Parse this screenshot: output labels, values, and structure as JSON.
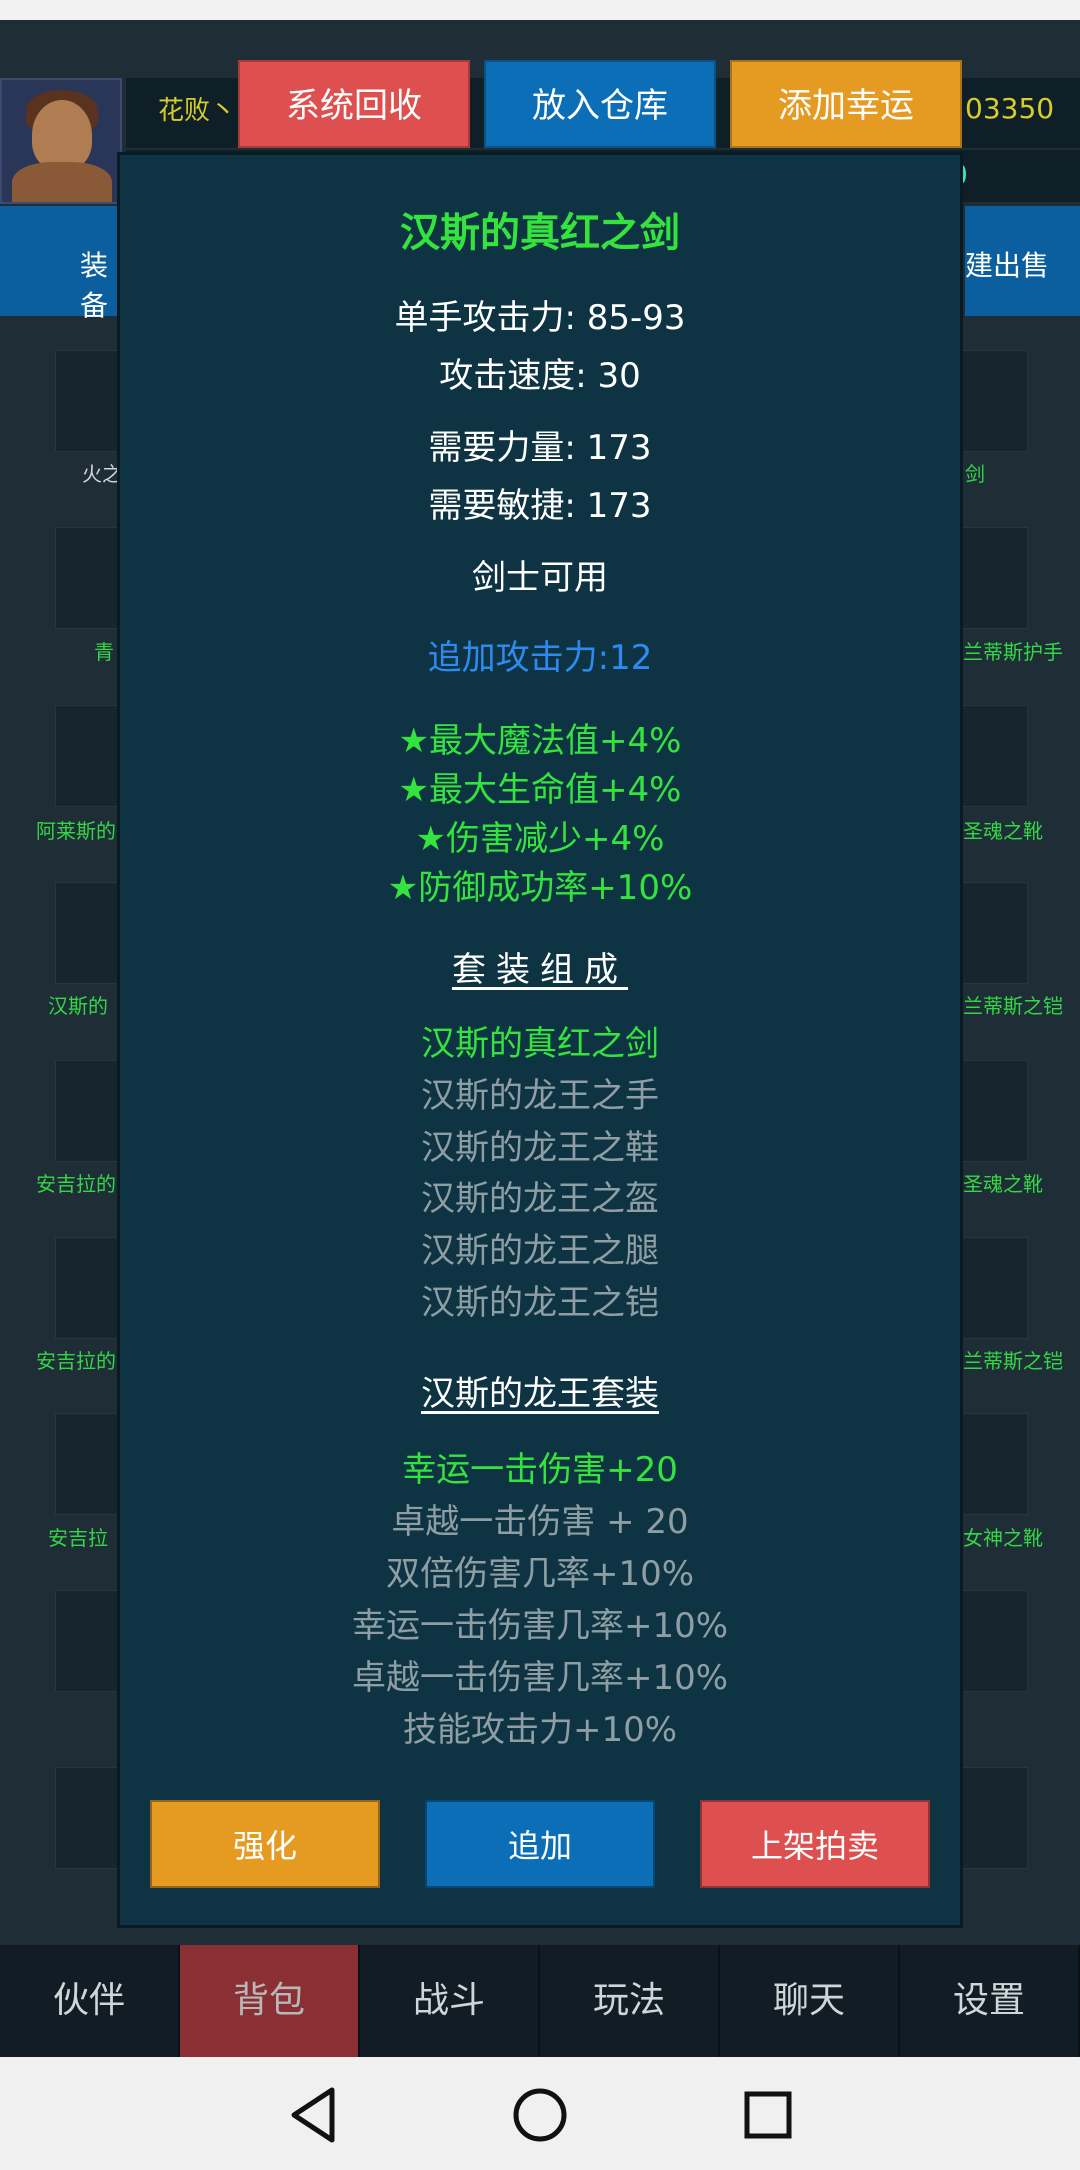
{
  "header": {
    "player_name": "花败丶",
    "gold": "03350",
    "indicator": "0",
    "left_tab": "装备",
    "right_tab": "建出售"
  },
  "inventory": {
    "left_labels": [
      "火之",
      "青",
      "阿莱斯的",
      "汉斯的",
      "安吉拉的",
      "安吉拉的",
      "安吉拉"
    ],
    "right_labels": [
      "剑",
      "兰蒂斯护手",
      "圣魂之靴",
      "兰蒂斯之铠",
      "圣魂之靴",
      "兰蒂斯之铠",
      "女神之靴"
    ]
  },
  "top_actions": {
    "recycle": "系统回收",
    "warehouse": "放入仓库",
    "luck": "添加幸运"
  },
  "item": {
    "name": "汉斯的真红之剑",
    "attack": "单手攻击力: 85-93",
    "speed": "攻击速度: 30",
    "req_str": "需要力量: 173",
    "req_agi": "需要敏捷: 173",
    "class": "剑士可用",
    "extra_attack": "追加攻击力:12",
    "excellent": [
      "★最大魔法值+4%",
      "★最大生命值+4%",
      "★伤害减少+4%",
      "★防御成功率+10%"
    ],
    "set_header": "套装组成",
    "set_parts": [
      "汉斯的真红之剑",
      "汉斯的龙王之手",
      "汉斯的龙王之鞋",
      "汉斯的龙王之盔",
      "汉斯的龙王之腿",
      "汉斯的龙王之铠"
    ],
    "set_name": "汉斯的龙王套装",
    "set_bonus": [
      "幸运一击伤害+20",
      "卓越一击伤害 + 20",
      "双倍伤害几率+10%",
      "幸运一击伤害几率+10%",
      "卓越一击伤害几率+10%",
      "技能攻击力+10%"
    ]
  },
  "bottom_actions": {
    "enhance": "强化",
    "add": "追加",
    "auction": "上架拍卖"
  },
  "nav": [
    "伙伴",
    "背包",
    "战斗",
    "玩法",
    "聊天",
    "设置"
  ],
  "colors": {
    "set_active": "#35e33f",
    "set_inactive": "#8e9ea4",
    "nav_active": "#8a2f33"
  }
}
